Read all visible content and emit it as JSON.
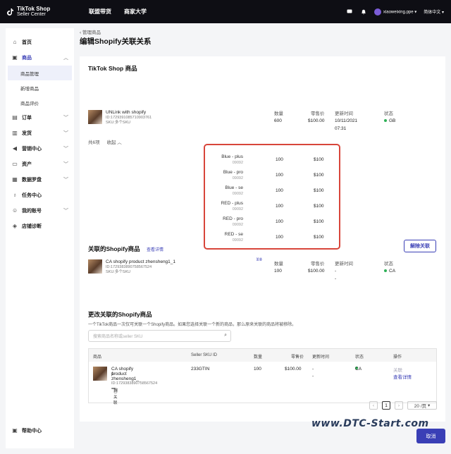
{
  "app": {
    "logo_line1": "TikTok Shop",
    "logo_line2": "Seller Center",
    "nav": [
      "联盟带货",
      "商家大学"
    ],
    "user": "xiaoweixing.ppe",
    "language": "简体中文",
    "accent": "#3a3fb6"
  },
  "sidebar": {
    "items": [
      {
        "label": "首页",
        "icon": "home-icon"
      },
      {
        "label": "商品",
        "icon": "bag-icon"
      },
      {
        "label": "商品管理",
        "icon": ""
      },
      {
        "label": "新增商品",
        "icon": ""
      },
      {
        "label": "商品评价",
        "icon": ""
      },
      {
        "label": "订单",
        "icon": "order-icon"
      },
      {
        "label": "发货",
        "icon": "truck-icon"
      },
      {
        "label": "营销中心",
        "icon": "megaphone-icon"
      },
      {
        "label": "资产",
        "icon": "wallet-icon"
      },
      {
        "label": "数据罗盘",
        "icon": "chart-icon"
      },
      {
        "label": "任务中心",
        "icon": "medal-icon"
      },
      {
        "label": "我的账号",
        "icon": "user-icon"
      },
      {
        "label": "店铺诊断",
        "icon": "shield-icon"
      }
    ],
    "help": "帮助中心"
  },
  "page": {
    "breadcrumb": "管理商品",
    "title": "编辑Shopify关联关系"
  },
  "tiktok": {
    "title": "TikTok Shop 商品",
    "columns": {
      "qty": "数量",
      "price": "零售价",
      "updated": "更新时间",
      "status": "状态"
    },
    "product": {
      "name": "UNLink with shopify",
      "id": "ID:1729391085710903761",
      "sku": "SKU:多个SKU",
      "qty": "600",
      "price": "$100.00",
      "updated_date": "10/11/2021",
      "updated_time": "07:31",
      "status": "GB"
    },
    "count": "共6项",
    "collapse": "收起",
    "skus": [
      {
        "name": "Blue - plus",
        "code": "09092",
        "qty": "100",
        "price": "$100"
      },
      {
        "name": "Blue - pro",
        "code": "09092",
        "qty": "100",
        "price": "$100"
      },
      {
        "name": "Blue - se",
        "code": "09092",
        "qty": "100",
        "price": "$100"
      },
      {
        "name": "RED - plus",
        "code": "09092",
        "qty": "100",
        "price": "$100"
      },
      {
        "name": "RED - pro",
        "code": "09092",
        "qty": "100",
        "price": "$100"
      },
      {
        "name": "RED - se",
        "code": "09092",
        "qty": "100",
        "price": "$100"
      }
    ]
  },
  "linked": {
    "title": "关联的Shopify商品",
    "details_link": "查看详情",
    "unlink_button": "解除关联",
    "columns": {
      "qty": "数量",
      "price": "零售价",
      "updated": "更新时间",
      "status": "状态"
    },
    "product": {
      "name": "CA shopify product zhensheng1_1",
      "id": "ID:1729383890758567524",
      "sku": "SKU:多个SKU",
      "qty": "100",
      "price": "$100.00",
      "updated": "-",
      "updated2": "-",
      "status": "CA"
    }
  },
  "change": {
    "title": "更改关联的Shopify商品",
    "note": "一个TikTok商品一次仅可关联一个Shopify商品。如果您选择关联一个新的商品，那么原来关联的商品将被移除。",
    "search_placeholder": "搜索商品名称或seller SKU",
    "table_headers": [
      "商品",
      "Seller SKU ID",
      "数量",
      "零售价",
      "更新时间",
      "状态",
      "操作"
    ],
    "row": {
      "name_line1": "CA shopify product zhensheng1_",
      "name_line2": "1",
      "id": "ID:1729383890758567524",
      "tag": "已关联",
      "sku_id": "233GTIN",
      "qty": "100",
      "price": "$100.00",
      "updated": "-",
      "updated2": "-",
      "status": "CA",
      "action1": "关联",
      "action2": "查看详情"
    },
    "pager": {
      "current": "1",
      "page_size": "20 /页"
    }
  },
  "footer": {
    "cancel": "取消",
    "watermark": "www.DTC-Start.com"
  }
}
